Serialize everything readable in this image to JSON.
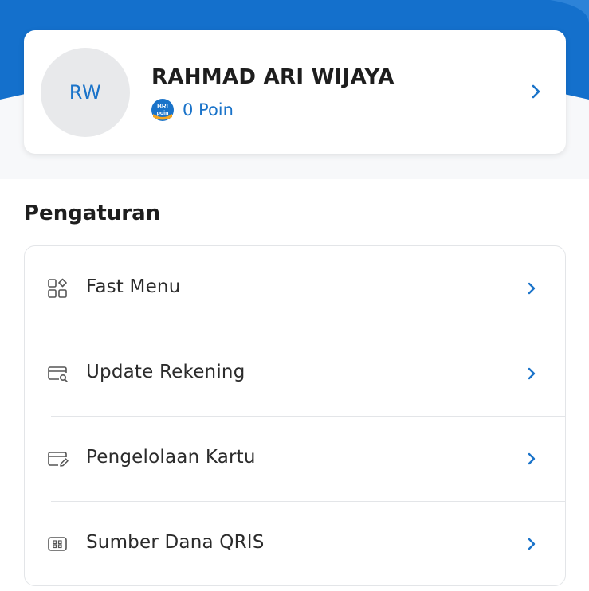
{
  "profile": {
    "initials": "RW",
    "name": "RAHMAD ARI WIJAYA",
    "points": "0 Poin",
    "points_badge_icon": "bri-poin-icon"
  },
  "settings": {
    "title": "Pengaturan",
    "items": [
      {
        "label": "Fast Menu",
        "icon": "grid-icon"
      },
      {
        "label": "Update Rekening",
        "icon": "card-search-icon"
      },
      {
        "label": "Pengelolaan Kartu",
        "icon": "card-edit-icon"
      },
      {
        "label": "Sumber Dana QRIS",
        "icon": "qris-icon"
      }
    ]
  },
  "colors": {
    "brand_blue": "#1a73c9",
    "header_blue": "#1470cc",
    "text_dark": "#1e1e1e",
    "divider": "#e3e5e8"
  }
}
